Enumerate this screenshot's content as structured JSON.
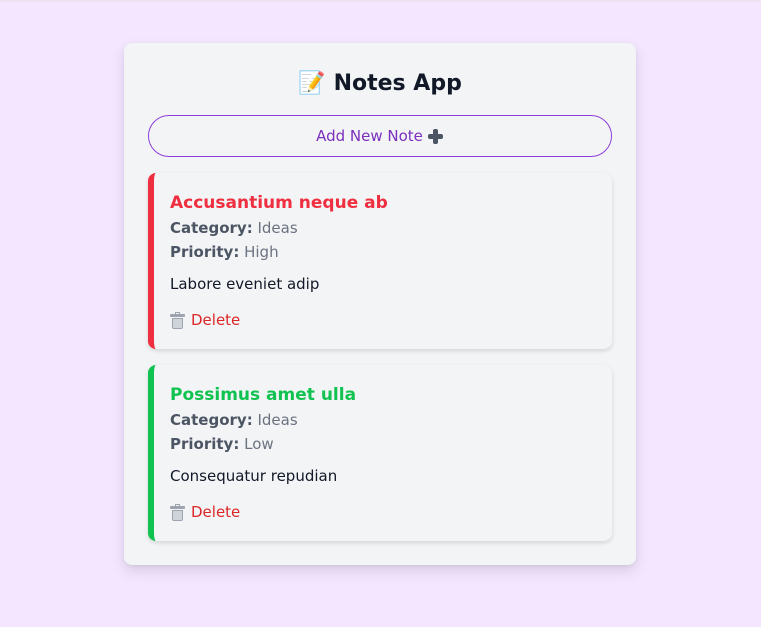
{
  "app": {
    "title_emoji": "📝",
    "title": "Notes App",
    "add_button_label": "Add New Note",
    "add_button_icon": "heavy-plus-icon"
  },
  "labels": {
    "category": "Category:",
    "priority": "Priority:",
    "delete": "Delete",
    "delete_icon": "wastebasket-icon"
  },
  "notes": [
    {
      "title": "Accusantium neque ab",
      "category": "Ideas",
      "priority": "High",
      "content": "Labore eveniet adip",
      "accent_color": "#ef2e3f"
    },
    {
      "title": "Possimus amet ulla",
      "category": "Ideas",
      "priority": "Low",
      "content": "Consequatur repudian",
      "accent_color": "#10c24f"
    }
  ],
  "colors": {
    "background": "#f5e6ff",
    "card": "#f3f4f6",
    "accent_purple": "#7b2fbf",
    "delete_red": "#dc2626"
  }
}
